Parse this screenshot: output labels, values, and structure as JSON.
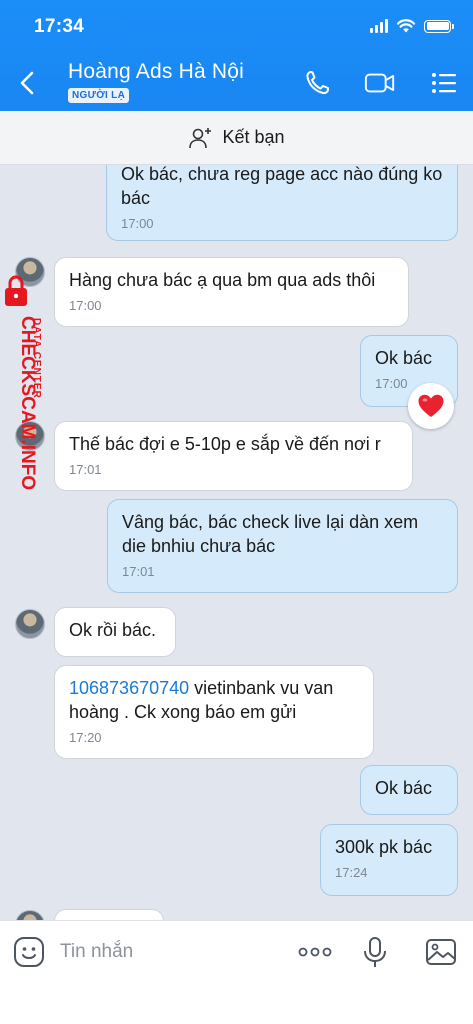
{
  "status_bar": {
    "time": "17:34"
  },
  "header": {
    "contact_name": "Hoàng Ads Hà Nội",
    "badge": "NGƯỜI LẠ"
  },
  "add_friend": {
    "label": "Kết bạn"
  },
  "watermark": {
    "line1": "DATA CENTER",
    "line2": "CHECKSCAM.INFO"
  },
  "messages": [
    {
      "dir": "out",
      "text": "Ok bác, chưa reg page acc nào đúng ko bác",
      "time": "17:00"
    },
    {
      "dir": "in",
      "text": "Hàng chưa bác ạ qua bm qua ads thôi",
      "time": "17:00"
    },
    {
      "dir": "out",
      "text": "Ok bác",
      "time": "17:00",
      "reaction": "heart"
    },
    {
      "dir": "in",
      "text": "Thế bác đợi e 5-10p e sắp về đến nơi r",
      "time": "17:01"
    },
    {
      "dir": "out",
      "text": "Vâng bác, bác check live lại dàn xem die bnhiu chưa bác",
      "time": "17:01"
    },
    {
      "dir": "in",
      "text": "Ok rồi bác.",
      "time": ""
    },
    {
      "dir": "in",
      "link": "106873670740",
      "text": " vietinbank vu van hoàng . Ck xong báo em gửi",
      "time": "17:20"
    },
    {
      "dir": "out",
      "text": "Ok bác",
      "time": ""
    },
    {
      "dir": "out",
      "text": "300k pk bác",
      "time": "17:24"
    }
  ],
  "input": {
    "placeholder": "Tin nhắn"
  },
  "colors": {
    "header_blue": "#1a86f2",
    "outgoing_bubble": "#d5ebfb",
    "link": "#1a7bd6",
    "reaction_red": "#e8232f"
  }
}
